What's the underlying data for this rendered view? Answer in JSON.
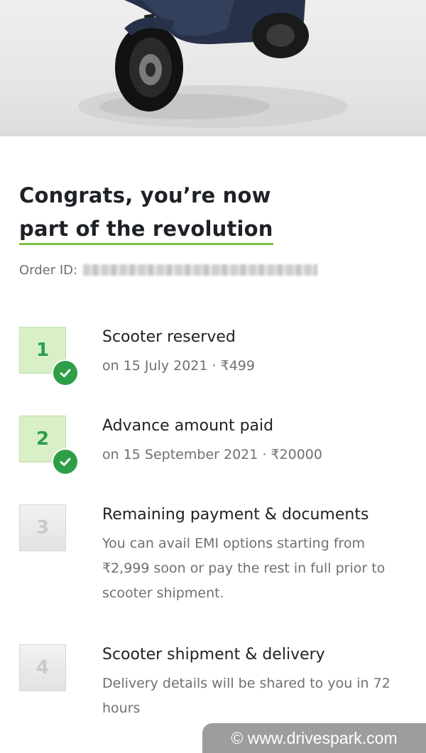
{
  "headline": {
    "line1": "Congrats, you’re now",
    "line2": "part of the revolution"
  },
  "order": {
    "label": "Order ID:"
  },
  "steps": [
    {
      "number": "1",
      "title": "Scooter reserved",
      "subtitle": "on 15 July 2021 · ₹499",
      "status": "completed"
    },
    {
      "number": "2",
      "title": "Advance amount paid",
      "subtitle": "on 15 September 2021 · ₹20000",
      "status": "completed"
    },
    {
      "number": "3",
      "title": "Remaining payment & documents",
      "subtitle": "You can avail EMI options starting from ₹2,999 soon or pay the rest in full prior to scooter shipment.",
      "status": "pending"
    },
    {
      "number": "4",
      "title": "Scooter shipment & delivery",
      "subtitle": "Delivery details will be shared to you in 72 hours",
      "status": "pending"
    }
  ],
  "watermark": "© www.drivespark.com",
  "colors": {
    "accent_green": "#7cc242",
    "check_green": "#2f9f47",
    "done_badge_bg": "#d8efc8",
    "text_dark": "#1e2126",
    "text_muted": "#707070"
  },
  "icons": {
    "check": "check-circle-icon",
    "hero": "scooter-image"
  }
}
